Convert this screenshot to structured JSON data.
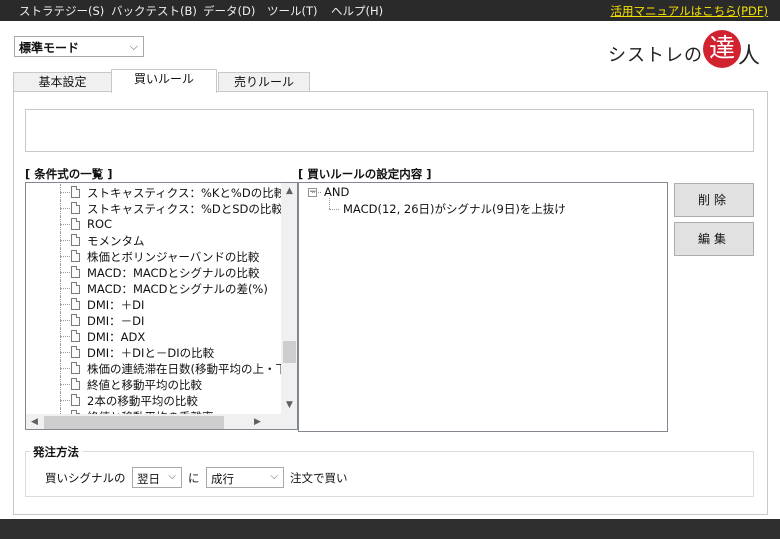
{
  "menu": {
    "items": [
      "ストラテジー(S)",
      "バックテスト(B)",
      "データ(D)",
      "ツール(T)",
      "ヘルプ(H)"
    ],
    "manual_link": "活用マニュアルはこちら(PDF)"
  },
  "mode_select": {
    "value": "標準モード"
  },
  "logo": {
    "text1": "シストレの",
    "seal": "達",
    "text2": "人"
  },
  "tabs": [
    "基本設定",
    "買いルール",
    "売りルール"
  ],
  "active_tab": "買いルール",
  "conditions": {
    "label": "[ 条件式の一覧 ]",
    "items": [
      "ストキャスティクス：%Kと%Dの比較",
      "ストキャスティクス：%DとSDの比較",
      "ROC",
      "モメンタム",
      "株価とボリンジャーバンドの比較",
      "MACD：MACDとシグナルの比較",
      "MACD：MACDとシグナルの差(%)",
      "DMI：＋DI",
      "DMI：－DI",
      "DMI：ADX",
      "DMI：＋DIと－DIの比較",
      "株価の連続滞在日数(移動平均の上・下)",
      "終値と移動平均の比較",
      "2本の移動平均の比較",
      "終値と移動平均の乖離率"
    ]
  },
  "rule": {
    "label": "[ 買いルールの設定内容 ]",
    "root": "AND",
    "expand_symbol": "−",
    "condition": "MACD(12, 26日)がシグナル(9日)を上抜け"
  },
  "buttons": {
    "delete": "削除",
    "edit": "編集"
  },
  "order": {
    "title": "発注方法",
    "prefix": "買いシグナルの",
    "day_value": "翌日",
    "particle": "に",
    "type_value": "成行",
    "suffix": "注文で買い"
  }
}
